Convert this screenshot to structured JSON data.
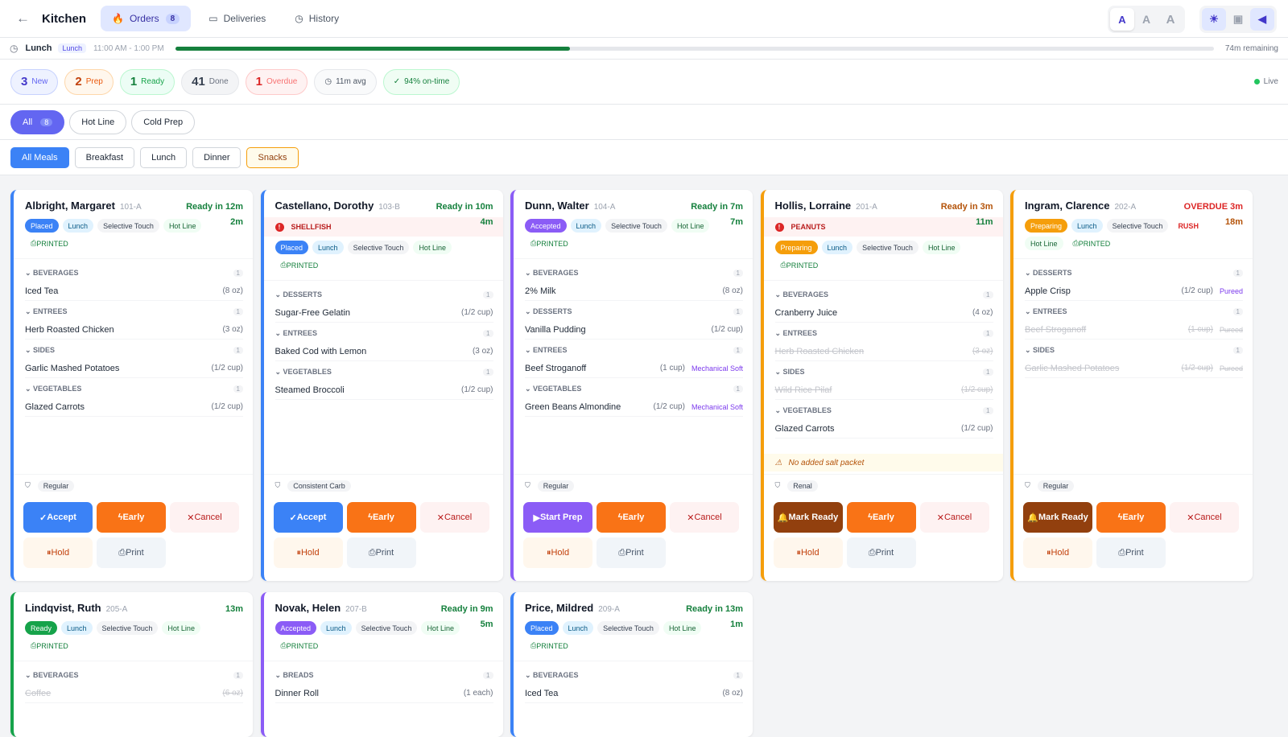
{
  "header": {
    "back": "←",
    "brand": "Kitchen",
    "nav": [
      {
        "label": "Orders",
        "count": "8",
        "icon": "flame"
      },
      {
        "label": "Deliveries",
        "icon": "truck"
      },
      {
        "label": "History",
        "icon": "clock"
      }
    ],
    "text_sizes": [
      "A",
      "A",
      "A"
    ]
  },
  "meal_bar": {
    "name": "Lunch",
    "tag": "Lunch",
    "range": "11:00 AM - 1:00 PM",
    "progress": 0.38,
    "remaining": "74m remaining"
  },
  "stats": [
    {
      "n": "3",
      "l": "New"
    },
    {
      "n": "2",
      "l": "Prep"
    },
    {
      "n": "1",
      "l": "Ready"
    },
    {
      "n": "41",
      "l": "Done"
    },
    {
      "n": "1",
      "l": "Overdue"
    }
  ],
  "avg": "11m avg",
  "ontime": "94% on-time",
  "live": "Live",
  "stations": [
    {
      "label": "All",
      "count": "8"
    },
    {
      "label": "Hot Line"
    },
    {
      "label": "Cold Prep"
    }
  ],
  "meals": [
    "All Meals",
    "Breakfast",
    "Lunch",
    "Dinner",
    "Snacks"
  ],
  "labels": {
    "printed": "PRINTED",
    "accept": "Accept",
    "early": "Early",
    "cancel": "Cancel",
    "hold": "Hold",
    "print": "Print",
    "start": "Start Prep",
    "mark": "Mark Ready"
  },
  "cards": [
    {
      "name": "Albright, Margaret",
      "room": "101-A",
      "ready": "Ready in 12m",
      "elapsed": "2m",
      "status": "Placed",
      "meal": "Lunch",
      "texture": "Selective Touch",
      "line": "Hot Line",
      "diet": "Regular",
      "groups": [
        {
          "cat": "BEVERAGES",
          "q": "1",
          "items": [
            {
              "n": "Iced Tea",
              "p": "(8 oz)"
            }
          ]
        },
        {
          "cat": "ENTREES",
          "q": "1",
          "items": [
            {
              "n": "Herb Roasted Chicken",
              "p": "(3 oz)"
            }
          ]
        },
        {
          "cat": "SIDES",
          "q": "1",
          "items": [
            {
              "n": "Garlic Mashed Potatoes",
              "p": "(1/2 cup)"
            }
          ]
        },
        {
          "cat": "VEGETABLES",
          "q": "1",
          "items": [
            {
              "n": "Glazed Carrots",
              "p": "(1/2 cup)"
            }
          ]
        }
      ]
    },
    {
      "name": "Castellano, Dorothy",
      "room": "103-B",
      "ready": "Ready in 10m",
      "elapsed": "4m",
      "allergy": "SHELLFISH",
      "status": "Placed",
      "meal": "Lunch",
      "texture": "Selective Touch",
      "line": "Hot Line",
      "diet": "Consistent Carb",
      "groups": [
        {
          "cat": "DESSERTS",
          "q": "1",
          "items": [
            {
              "n": "Sugar-Free Gelatin",
              "p": "(1/2 cup)"
            }
          ]
        },
        {
          "cat": "ENTREES",
          "q": "1",
          "items": [
            {
              "n": "Baked Cod with Lemon",
              "p": "(3 oz)"
            }
          ]
        },
        {
          "cat": "VEGETABLES",
          "q": "1",
          "items": [
            {
              "n": "Steamed Broccoli",
              "p": "(1/2 cup)"
            }
          ]
        }
      ]
    },
    {
      "name": "Dunn, Walter",
      "room": "104-A",
      "ready": "Ready in 7m",
      "elapsed": "7m",
      "status": "Accepted",
      "meal": "Lunch",
      "texture": "Selective Touch",
      "line": "Hot Line",
      "diet": "Regular",
      "groups": [
        {
          "cat": "BEVERAGES",
          "q": "1",
          "items": [
            {
              "n": "2% Milk",
              "p": "(8 oz)"
            }
          ]
        },
        {
          "cat": "DESSERTS",
          "q": "1",
          "items": [
            {
              "n": "Vanilla Pudding",
              "p": "(1/2 cup)"
            }
          ]
        },
        {
          "cat": "ENTREES",
          "q": "1",
          "items": [
            {
              "n": "Beef Stroganoff",
              "p": "(1 cup)",
              "m": "Mechanical Soft"
            }
          ]
        },
        {
          "cat": "VEGETABLES",
          "q": "1",
          "items": [
            {
              "n": "Green Beans Almondine",
              "p": "(1/2 cup)",
              "m": "Mechanical Soft"
            }
          ]
        }
      ]
    },
    {
      "name": "Hollis, Lorraine",
      "room": "201-A",
      "ready": "Ready in 3m",
      "elapsed": "11m",
      "allergy": "PEANUTS",
      "status": "Preparing",
      "meal": "Lunch",
      "texture": "Selective Touch",
      "line": "Hot Line",
      "diet": "Renal",
      "note": "No added salt packet",
      "groups": [
        {
          "cat": "BEVERAGES",
          "q": "1",
          "items": [
            {
              "n": "Cranberry Juice",
              "p": "(4 oz)"
            }
          ]
        },
        {
          "cat": "ENTREES",
          "q": "1",
          "items": [
            {
              "n": "Herb Roasted Chicken",
              "p": "(3 oz)",
              "s": true
            }
          ]
        },
        {
          "cat": "SIDES",
          "q": "1",
          "items": [
            {
              "n": "Wild Rice Pilaf",
              "p": "(1/2 cup)",
              "s": true
            }
          ]
        },
        {
          "cat": "VEGETABLES",
          "q": "1",
          "items": [
            {
              "n": "Glazed Carrots",
              "p": "(1/2 cup)"
            }
          ]
        }
      ]
    },
    {
      "name": "Ingram, Clarence",
      "room": "202-A",
      "ready": "OVERDUE 3m",
      "elapsed": "18m",
      "status": "Preparing",
      "meal": "Lunch",
      "texture": "Selective Touch",
      "rush": "RUSH",
      "line": "Hot Line",
      "diet": "Regular",
      "groups": [
        {
          "cat": "DESSERTS",
          "q": "1",
          "items": [
            {
              "n": "Apple Crisp",
              "p": "(1/2 cup)",
              "m": "Pureed"
            }
          ]
        },
        {
          "cat": "ENTREES",
          "q": "1",
          "items": [
            {
              "n": "Beef Stroganoff",
              "p": "(1 cup)",
              "m": "Pureed",
              "s": true
            }
          ]
        },
        {
          "cat": "SIDES",
          "q": "1",
          "items": [
            {
              "n": "Garlic Mashed Potatoes",
              "p": "(1/2 cup)",
              "m": "Pureed",
              "s": true
            }
          ]
        }
      ]
    },
    {
      "name": "Lindqvist, Ruth",
      "room": "205-A",
      "ready": "",
      "elapsed": "13m",
      "status": "Ready",
      "meal": "Lunch",
      "texture": "Selective Touch",
      "line": "Hot Line",
      "groups": [
        {
          "cat": "BEVERAGES",
          "q": "1",
          "items": [
            {
              "n": "Coffee",
              "p": "(6 oz)",
              "s": true
            }
          ]
        }
      ]
    },
    {
      "name": "Novak, Helen",
      "room": "207-B",
      "ready": "Ready in 9m",
      "elapsed": "5m",
      "status": "Accepted",
      "meal": "Lunch",
      "texture": "Selective Touch",
      "line": "Hot Line",
      "groups": [
        {
          "cat": "BREADS",
          "q": "1",
          "items": [
            {
              "n": "Dinner Roll",
              "p": "(1 each)"
            }
          ]
        }
      ]
    },
    {
      "name": "Price, Mildred",
      "room": "209-A",
      "ready": "Ready in 13m",
      "elapsed": "1m",
      "status": "Placed",
      "meal": "Lunch",
      "texture": "Selective Touch",
      "line": "Hot Line",
      "groups": [
        {
          "cat": "BEVERAGES",
          "q": "1",
          "items": [
            {
              "n": "Iced Tea",
              "p": "(8 oz)"
            }
          ]
        }
      ]
    }
  ]
}
